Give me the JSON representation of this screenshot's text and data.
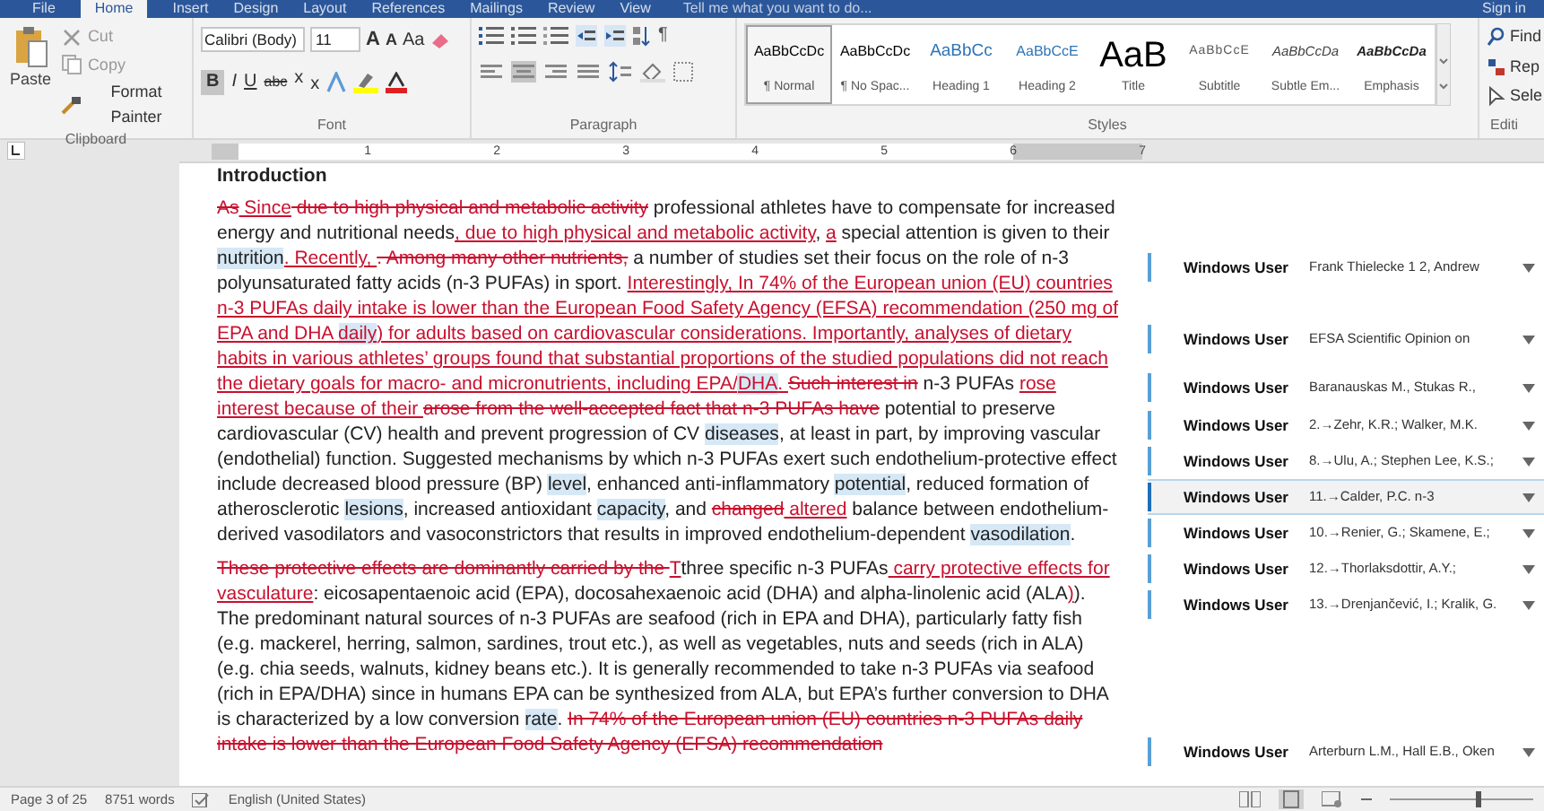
{
  "tabs": [
    {
      "label": "File",
      "selected": false
    },
    {
      "label": "Home",
      "selected": true
    },
    {
      "label": "Insert",
      "selected": false
    },
    {
      "label": "Design",
      "selected": false
    },
    {
      "label": "Layout",
      "selected": false
    },
    {
      "label": "References",
      "selected": false
    },
    {
      "label": "Mailings",
      "selected": false
    },
    {
      "label": "Review",
      "selected": false
    },
    {
      "label": "View",
      "selected": false
    }
  ],
  "tell_me": "Tell me what you want to do...",
  "sign_in": "Sign in",
  "clipboard": {
    "paste": "Paste",
    "items": [
      "Cut",
      "Copy",
      "Format Painter"
    ],
    "label": "Clipboard"
  },
  "font": {
    "name": "Calibri (Body)",
    "size": "11",
    "grow": "A",
    "shrink": "A",
    "case": "Aa",
    "format_buttons": [
      "B",
      "I",
      "U",
      "abc",
      "x",
      "x"
    ],
    "label": "Font"
  },
  "paragraph": {
    "pilcrow": "¶",
    "label": "Paragraph"
  },
  "styles": {
    "label": "Styles",
    "items": [
      {
        "preview": "AaBbCcDc",
        "name": "¶ Normal",
        "selected": true
      },
      {
        "preview": "AaBbCcDc",
        "name": "¶ No Spac...",
        "selected": false
      },
      {
        "preview": "AaBbCc",
        "name": "Heading 1",
        "selected": false
      },
      {
        "preview": "AaBbCcE",
        "name": "Heading 2",
        "selected": false
      },
      {
        "preview": "AaB",
        "name": "Title",
        "selected": false
      },
      {
        "preview": "AaBbCcE",
        "name": "Subtitle",
        "selected": false
      },
      {
        "preview": "AaBbCcDa",
        "name": "Subtle Em...",
        "selected": false
      },
      {
        "preview": "AaBbCcDa",
        "name": "Emphasis",
        "selected": false
      }
    ]
  },
  "editing": {
    "items": [
      "Find",
      "Rep",
      "Sele"
    ],
    "label": "Editi"
  },
  "ruler": [
    "1",
    "2",
    "3",
    "4",
    "5",
    "6",
    "7"
  ],
  "heading": "Introduction",
  "paragraphs": [
    [
      {
        "kind": "delete",
        "text": "As"
      },
      {
        "kind": "insert",
        "text": " Since"
      },
      {
        "kind": "delete",
        "text": " due to high physical and metabolic activity"
      },
      {
        "kind": "normal",
        "text": " professional athletes have to compensate for increased energy and nutritional needs"
      },
      {
        "kind": "insert",
        "text": ", due to high physical and metabolic activity"
      },
      {
        "kind": "normal",
        "text": ", "
      },
      {
        "kind": "insert",
        "text": "a"
      },
      {
        "kind": "normal",
        "text": " special attention is given to their "
      },
      {
        "kind": "comment",
        "text": "nutrition"
      },
      {
        "kind": "insert",
        "text": ". Recently, "
      },
      {
        "kind": "delete",
        "text": ". Among many other nutrients,"
      },
      {
        "kind": "normal",
        "text": " a number of studies set their focus on the role of n-3 polyunsaturated fatty acids (n-3 PUFAs) in sport. "
      },
      {
        "kind": "insert",
        "text": "Interestingly, In 74% of the European union (EU) countries n-3 PUFAs daily intake is lower than the European Food Safety Agency (EFSA) recommendation (250 mg of EPA and DHA "
      },
      {
        "kind": "insert_comment",
        "text": "daily"
      },
      {
        "kind": "insert",
        "text": ") for adults based on cardiovascular considerations. Importantly, analyses of dietary habits in various athletes’ groups  found that substantial proportions of the studied populations did not reach the dietary goals for macro- and micronutrients, including EPA/"
      },
      {
        "kind": "insert_comment",
        "text": "DHA"
      },
      {
        "kind": "insert",
        "text": ". "
      },
      {
        "kind": "delete",
        "text": "Such interest in"
      },
      {
        "kind": "normal",
        "text": " n-3 PUFAs "
      },
      {
        "kind": "insert",
        "text": "rose interest because of their "
      },
      {
        "kind": "delete",
        "text": "arose from the well-accepted fact that n-3 PUFAs have"
      },
      {
        "kind": "normal",
        "text": " potential to preserve cardiovascular (CV) health and prevent progression of CV "
      },
      {
        "kind": "comment",
        "text": "diseases"
      },
      {
        "kind": "normal",
        "text": ", at least in part, by improving vascular (endothelial) function. Suggested mechanisms by which n-3 PUFAs exert such endothelium-protective effect include decreased blood pressure (BP) "
      },
      {
        "kind": "comment",
        "text": "level"
      },
      {
        "kind": "normal",
        "text": ", enhanced anti-inflammatory "
      },
      {
        "kind": "comment",
        "text": "potential"
      },
      {
        "kind": "normal",
        "text": ", reduced formation of atherosclerotic "
      },
      {
        "kind": "comment",
        "text": "lesions"
      },
      {
        "kind": "normal",
        "text": ", increased antioxidant "
      },
      {
        "kind": "comment",
        "text": "capacity"
      },
      {
        "kind": "normal",
        "text": ", and "
      },
      {
        "kind": "delete",
        "text": "changed"
      },
      {
        "kind": "insert",
        "text": " altered"
      },
      {
        "kind": "normal",
        "text": " balance between endothelium-derived vasodilators and vasoconstrictors that results in improved endothelium-dependent "
      },
      {
        "kind": "comment",
        "text": "vasodilation"
      },
      {
        "kind": "normal",
        "text": "."
      }
    ],
    [
      {
        "kind": "delete",
        "text": "These protective effects are dominantly carried by the "
      },
      {
        "kind": "insert",
        "text": "T"
      },
      {
        "kind": "normal",
        "text": "three specific n-3 PUFAs"
      },
      {
        "kind": "insert",
        "text": " carry protective effects for vasculature"
      },
      {
        "kind": "normal",
        "text": ": eicosapentaenoic acid (EPA), docosahexaenoic acid (DHA) and alpha-linolenic acid (ALA"
      },
      {
        "kind": "insert",
        "text": ")"
      },
      {
        "kind": "normal",
        "text": "). The predominant natural sources of n-3 PUFAs are seafood (rich in EPA and DHA), particularly fatty fish (e.g. mackerel, herring, salmon, sardines, trout etc.), as well as vegetables, nuts and seeds (rich in ALA) (e.g. chia seeds, walnuts, kidney beans etc.). It is generally recommended to take n-3 PUFAs via seafood (rich in EPA/DHA) since in humans EPA can be synthesized from ALA, but EPA’s further conversion to DHA is characterized by a low conversion "
      },
      {
        "kind": "comment",
        "text": "rate"
      },
      {
        "kind": "normal",
        "text": ". "
      },
      {
        "kind": "delete",
        "text": "In 74% of the European union (EU) countries n-3 PUFAs daily intake is lower than the European Food Safety Agency (EFSA) recommendation"
      }
    ]
  ],
  "comments": [
    {
      "author": "Windows User",
      "text": "Frank Thielecke 1 2, Andrew",
      "selected": false
    },
    {
      "author": "Windows User",
      "text": "EFSA Scientific Opinion on",
      "selected": false
    },
    {
      "author": "Windows User",
      "text": "Baranauskas M., Stukas R.,",
      "selected": false
    },
    {
      "author": "Windows User",
      "text": "2.→Zehr, K.R.; Walker, M.K.",
      "selected": false
    },
    {
      "author": "Windows User",
      "text": "8.→Ulu, A.; Stephen Lee, K.S.;",
      "selected": false
    },
    {
      "author": "Windows User",
      "text": "11.→Calder, P.C. n-3",
      "selected": true
    },
    {
      "author": "Windows User",
      "text": "10.→Renier, G.; Skamene, E.;",
      "selected": false
    },
    {
      "author": "Windows User",
      "text": "12.→Thorlaksdottir, A.Y.;",
      "selected": false
    },
    {
      "author": "Windows User",
      "text": "13.→Drenjančević, I.; Kralik, G.",
      "selected": false
    },
    {
      "author": "Windows User",
      "text": "Arterburn L.M., Hall E.B., Oken",
      "selected": false
    }
  ],
  "status_bar": {
    "page": "Page 3 of 25",
    "words": "8751 words",
    "language": "English (United States)",
    "zoom": {
      "level": 0.6
    }
  }
}
